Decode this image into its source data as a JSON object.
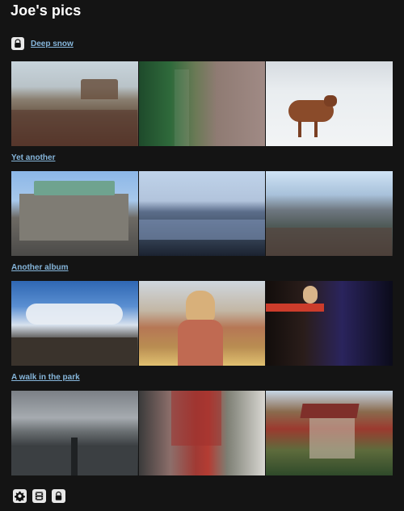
{
  "page": {
    "title": "Joe's pics"
  },
  "albums": [
    {
      "name": "Deep snow",
      "locked": true
    },
    {
      "name": "Yet another",
      "locked": false
    },
    {
      "name": "Another album",
      "locked": false
    },
    {
      "name": "A walk in the park",
      "locked": false
    }
  ],
  "toolbar": [
    {
      "icon": "gear-icon"
    },
    {
      "icon": "film-icon"
    },
    {
      "icon": "lock-icon"
    }
  ]
}
